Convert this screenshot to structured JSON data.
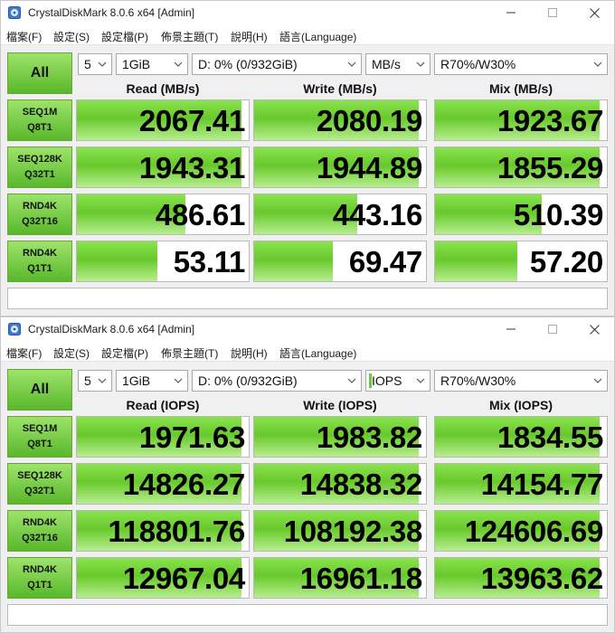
{
  "windows": [
    {
      "title": "CrystalDiskMark 8.0.6 x64 [Admin]",
      "menu": [
        "檔案(F)",
        "設定(S)",
        "設定檔(P)",
        "佈景主題(T)",
        "說明(H)",
        "語言(Language)"
      ],
      "all_label": "All",
      "count": "5",
      "size": "1GiB",
      "drive": "D: 0% (0/932GiB)",
      "unit": "MB/s",
      "unit_highlight": false,
      "mix_ratio": "R70%/W30%",
      "headers": [
        "Read (MB/s)",
        "Write (MB/s)",
        "Mix (MB/s)"
      ],
      "rows": [
        {
          "label1": "SEQ1M",
          "label2": "Q8T1",
          "values": [
            "2067.41",
            "2080.19",
            "1923.67"
          ],
          "fills": [
            0.96,
            0.96,
            0.96
          ]
        },
        {
          "label1": "SEQ128K",
          "label2": "Q32T1",
          "values": [
            "1943.31",
            "1944.89",
            "1855.29"
          ],
          "fills": [
            0.96,
            0.96,
            0.96
          ]
        },
        {
          "label1": "RND4K",
          "label2": "Q32T16",
          "values": [
            "486.61",
            "443.16",
            "510.39"
          ],
          "fills": [
            0.63,
            0.6,
            0.62
          ]
        },
        {
          "label1": "RND4K",
          "label2": "Q1T1",
          "values": [
            "53.11",
            "69.47",
            "57.20"
          ],
          "fills": [
            0.47,
            0.46,
            0.48
          ]
        }
      ],
      "comment": ""
    },
    {
      "title": "CrystalDiskMark 8.0.6 x64 [Admin]",
      "menu": [
        "檔案(F)",
        "設定(S)",
        "設定檔(P)",
        "佈景主題(T)",
        "說明(H)",
        "語言(Language)"
      ],
      "all_label": "All",
      "count": "5",
      "size": "1GiB",
      "drive": "D: 0% (0/932GiB)",
      "unit": "IOPS",
      "unit_highlight": true,
      "mix_ratio": "R70%/W30%",
      "headers": [
        "Read (IOPS)",
        "Write (IOPS)",
        "Mix (IOPS)"
      ],
      "rows": [
        {
          "label1": "SEQ1M",
          "label2": "Q8T1",
          "values": [
            "1971.63",
            "1983.82",
            "1834.55"
          ],
          "fills": [
            0.96,
            0.96,
            0.96
          ]
        },
        {
          "label1": "SEQ128K",
          "label2": "Q32T1",
          "values": [
            "14826.27",
            "14838.32",
            "14154.77"
          ],
          "fills": [
            0.96,
            0.96,
            0.96
          ]
        },
        {
          "label1": "RND4K",
          "label2": "Q32T16",
          "values": [
            "118801.76",
            "108192.38",
            "124606.69"
          ],
          "fills": [
            0.96,
            0.96,
            0.96
          ]
        },
        {
          "label1": "RND4K",
          "label2": "Q1T1",
          "values": [
            "12967.04",
            "16961.18",
            "13963.62"
          ],
          "fills": [
            0.96,
            0.96,
            0.96
          ]
        }
      ],
      "comment": ""
    }
  ],
  "icons": {
    "app": "crystaldiskmark-app-icon",
    "minimize": "minimize-icon",
    "maximize": "maximize-icon",
    "close": "close-icon",
    "dropdown": "chevron-down-icon"
  },
  "colors": {
    "accent_green": "#66cc33",
    "bar_green": "#8ae34e",
    "button_green": "#59b82a"
  }
}
